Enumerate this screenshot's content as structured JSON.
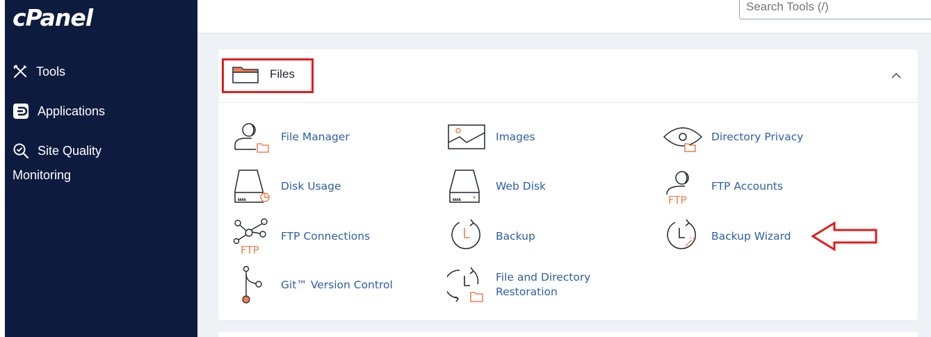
{
  "sidebar": {
    "logo": "cPanel",
    "items": [
      {
        "label": "Tools"
      },
      {
        "label": "Applications"
      },
      {
        "label": "Site Quality"
      }
    ],
    "subtext": "Monitoring"
  },
  "search": {
    "placeholder": "Search Tools (/)"
  },
  "panel": {
    "title": "Files",
    "tools": [
      {
        "label": "File Manager",
        "icon": "file-manager-icon"
      },
      {
        "label": "Images",
        "icon": "images-icon"
      },
      {
        "label": "Directory Privacy",
        "icon": "eye-icon"
      },
      {
        "label": "Disk Usage",
        "icon": "disk-usage-icon"
      },
      {
        "label": "Web Disk",
        "icon": "web-disk-icon"
      },
      {
        "label": "FTP Accounts",
        "icon": "ftp-accounts-icon"
      },
      {
        "label": "FTP Connections",
        "icon": "ftp-connections-icon"
      },
      {
        "label": "Backup",
        "icon": "backup-icon"
      },
      {
        "label": "Backup Wizard",
        "icon": "backup-wizard-icon"
      },
      {
        "label": "Git™ Version Control",
        "icon": "git-icon"
      },
      {
        "label": "File and Directory Restoration",
        "label_line1": "File and Directory",
        "label_line2": "Restoration",
        "icon": "restoration-icon"
      }
    ]
  },
  "colors": {
    "sidebar_bg": "#0d1b3e",
    "accent_orange": "#ef7d4f",
    "link_blue": "#2b5fa8",
    "highlight_red": "#e11c1c"
  }
}
